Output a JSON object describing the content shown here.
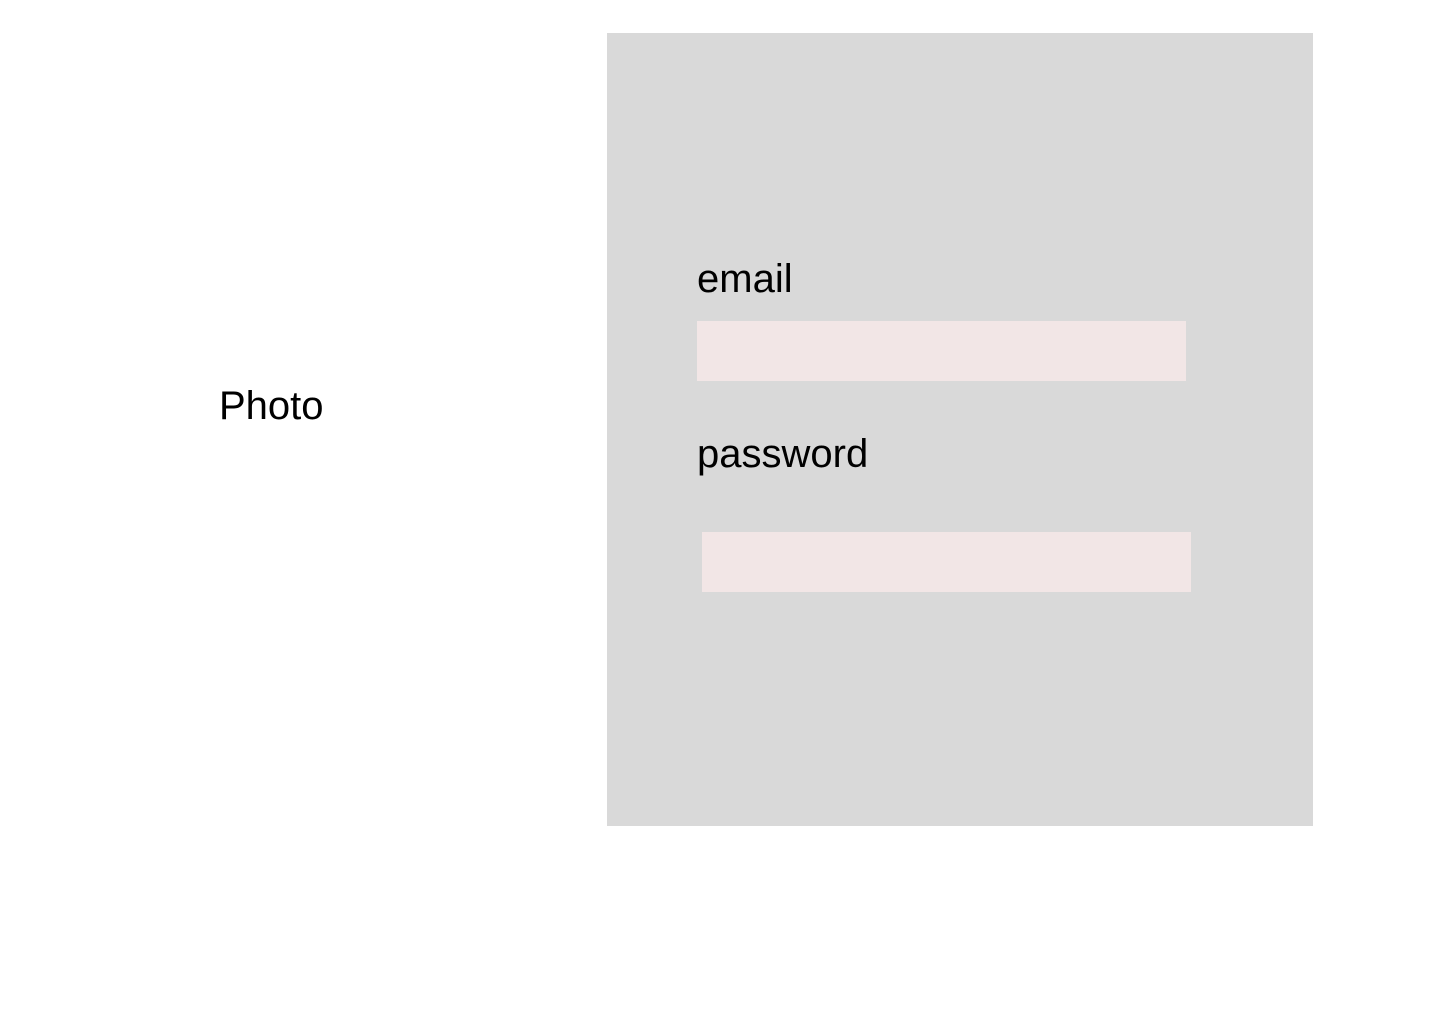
{
  "photo": {
    "label": "Photo"
  },
  "login_form": {
    "email": {
      "label": "email",
      "value": "",
      "placeholder": ""
    },
    "password": {
      "label": "password",
      "value": "",
      "placeholder": ""
    }
  },
  "colors": {
    "page_background": "#FFFFFF",
    "panel_background": "#D9D9D9",
    "input_background": "#F2E6E6",
    "text": "#000000"
  }
}
